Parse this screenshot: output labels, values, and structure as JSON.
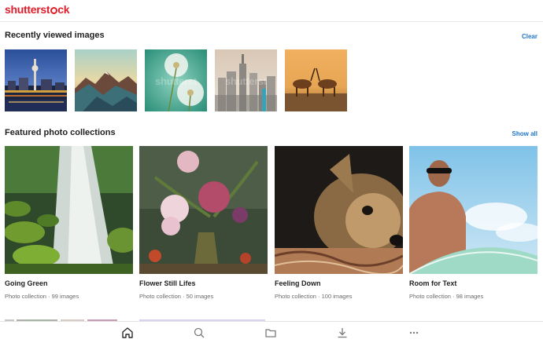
{
  "app": {
    "logo_part1": "shutterst",
    "logo_part2": "ck"
  },
  "recent": {
    "title": "Recently viewed images",
    "clear_label": "Clear",
    "watermark": "shutterst",
    "items": [
      {
        "icon": "berlin-skyline-image"
      },
      {
        "icon": "mountain-lake-image"
      },
      {
        "icon": "dandelion-image"
      },
      {
        "icon": "city-skyline-image"
      },
      {
        "icon": "antelopes-image"
      }
    ]
  },
  "featured": {
    "title": "Featured photo collections",
    "show_all_label": "Show all",
    "collections": [
      {
        "title": "Going Green",
        "subtitle": "Photo collection · 99 images",
        "icon": "waterfall-image"
      },
      {
        "title": "Flower Still Lifes",
        "subtitle": "Photo collection · 50 images",
        "icon": "flowers-vase-image"
      },
      {
        "title": "Feeling Down",
        "subtitle": "Photo collection · 100 images",
        "icon": "dog-image"
      },
      {
        "title": "Room for Text",
        "subtitle": "Photo collection · 98 images",
        "icon": "surfer-image"
      }
    ]
  },
  "bottom_nav": {
    "items": [
      {
        "name": "home",
        "icon": "home-icon",
        "active": true
      },
      {
        "name": "search",
        "icon": "search-icon",
        "active": false
      },
      {
        "name": "collections",
        "icon": "folder-icon",
        "active": false
      },
      {
        "name": "downloads",
        "icon": "download-icon",
        "active": false
      },
      {
        "name": "more",
        "icon": "more-icon",
        "active": false
      }
    ]
  },
  "colors": {
    "brand": "#e01e2b",
    "link": "#1e76c9"
  }
}
